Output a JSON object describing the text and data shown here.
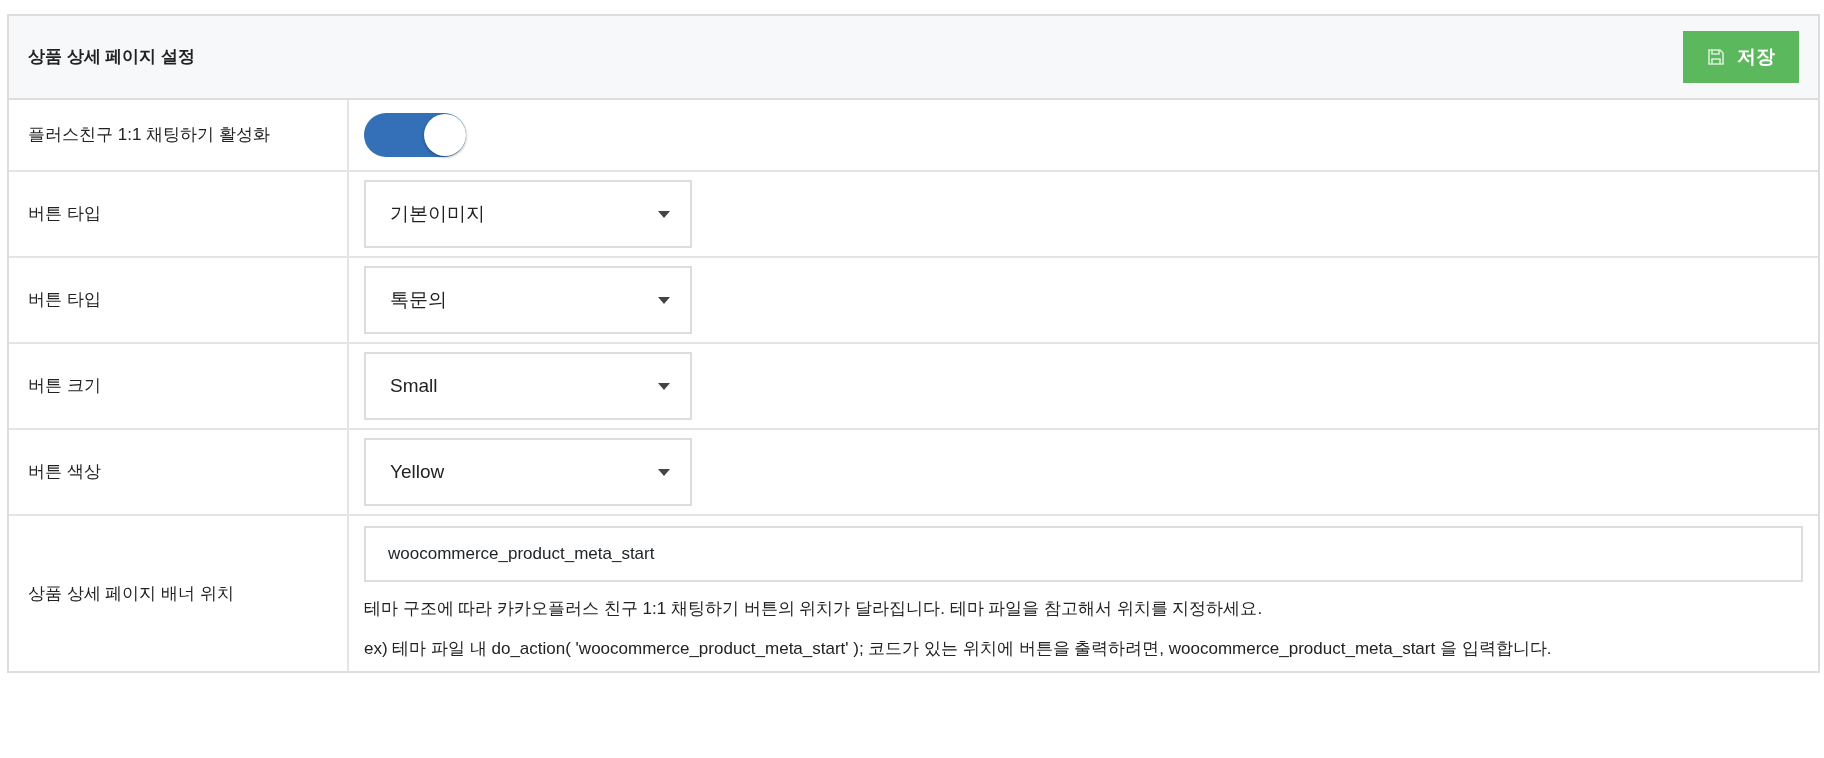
{
  "panel": {
    "title": "상품 상세 페이지 설정",
    "save_button": "저장"
  },
  "rows": [
    {
      "kind": "toggle",
      "label": "플러스친구 1:1 채팅하기 활성화",
      "on": true
    },
    {
      "kind": "select",
      "label": "버튼 타입",
      "value": "기본이미지"
    },
    {
      "kind": "select",
      "label": "버튼 타입",
      "value": "톡문의"
    },
    {
      "kind": "select",
      "label": "버튼 크기",
      "value": "Small"
    },
    {
      "kind": "select",
      "label": "버튼 색상",
      "value": "Yellow"
    },
    {
      "kind": "text",
      "label": "상품 상세 페이지 배너 위치",
      "value": "woocommerce_product_meta_start",
      "help": [
        "테마 구조에 따라 카카오플러스 친구 1:1 채팅하기 버튼의 위치가 달라집니다. 테마 파일을 참고해서 위치를 지정하세요.",
        "ex) 테마 파일 내 do_action( 'woocommerce_product_meta_start' ); 코드가 있는 위치에 버튼을 출력하려면, woocommerce_product_meta_start 을 입력합니다."
      ]
    }
  ]
}
